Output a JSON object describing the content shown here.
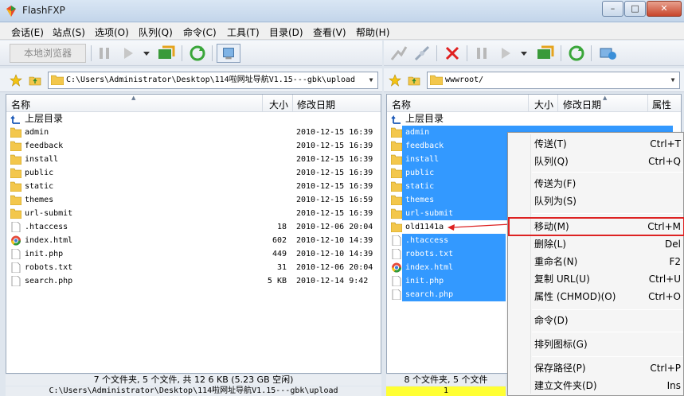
{
  "window": {
    "title": "FlashFXP",
    "min_label": "–",
    "max_label": "□",
    "close_label": "✕"
  },
  "menu": [
    "会话(E)",
    "站点(S)",
    "选项(O)",
    "队列(Q)",
    "命令(C)",
    "工具(T)",
    "目录(D)",
    "查看(V)",
    "帮助(H)"
  ],
  "toolbar_left": {
    "local_browser_label": "本地浏览器"
  },
  "left_pane": {
    "path": "C:\\Users\\Administrator\\Desktop\\114啦网址导航V1.15---gbk\\upload",
    "columns": {
      "name": "名称",
      "size": "大小",
      "date": "修改日期"
    },
    "up_label": "上层目录",
    "rows": [
      {
        "name": "admin",
        "size": "",
        "date": "2010-12-15 16:39",
        "type": "folder"
      },
      {
        "name": "feedback",
        "size": "",
        "date": "2010-12-15 16:39",
        "type": "folder"
      },
      {
        "name": "install",
        "size": "",
        "date": "2010-12-15 16:39",
        "type": "folder"
      },
      {
        "name": "public",
        "size": "",
        "date": "2010-12-15 16:39",
        "type": "folder"
      },
      {
        "name": "static",
        "size": "",
        "date": "2010-12-15 16:39",
        "type": "folder"
      },
      {
        "name": "themes",
        "size": "",
        "date": "2010-12-15 16:59",
        "type": "folder"
      },
      {
        "name": "url-submit",
        "size": "",
        "date": "2010-12-15 16:39",
        "type": "folder"
      },
      {
        "name": ".htaccess",
        "size": "18",
        "date": "2010-12-06 20:04",
        "type": "file"
      },
      {
        "name": "index.html",
        "size": "602",
        "date": "2010-12-10 14:39",
        "type": "html"
      },
      {
        "name": "init.php",
        "size": "449",
        "date": "2010-12-10 14:39",
        "type": "file"
      },
      {
        "name": "robots.txt",
        "size": "31",
        "date": "2010-12-06 20:04",
        "type": "file"
      },
      {
        "name": "search.php",
        "size": "5 KB",
        "date": "2010-12-14 9:42",
        "type": "file"
      }
    ],
    "status": "7 个文件夹, 5 个文件, 共 12 6 KB (5.23 GB 空闲)",
    "path_status": "C:\\Users\\Administrator\\Desktop\\114啦网址导航V1.15---gbk\\upload"
  },
  "right_pane": {
    "path": "wwwroot/",
    "columns": {
      "name": "名称",
      "size": "大小",
      "date": "修改日期",
      "attr": "属性"
    },
    "up_label": "上层目录",
    "rows": [
      {
        "name": "admin",
        "type": "folder",
        "selected": true
      },
      {
        "name": "feedback",
        "type": "folder",
        "selected": true
      },
      {
        "name": "install",
        "type": "folder",
        "selected": true
      },
      {
        "name": "public",
        "type": "folder",
        "selected": true
      },
      {
        "name": "static",
        "type": "folder",
        "selected": true
      },
      {
        "name": "themes",
        "type": "folder",
        "selected": true
      },
      {
        "name": "url-submit",
        "type": "folder",
        "selected": true
      },
      {
        "name": "old1141a",
        "type": "folder",
        "selected": false
      },
      {
        "name": ".htaccess",
        "type": "file",
        "selected": true
      },
      {
        "name": "robots.txt",
        "type": "file",
        "selected": true
      },
      {
        "name": "index.html",
        "type": "html",
        "selected": true
      },
      {
        "name": "init.php",
        "type": "file",
        "selected": true
      },
      {
        "name": "search.php",
        "type": "file",
        "selected": true
      }
    ],
    "status": "8 个文件夹, 5 个文件",
    "path_status": "1"
  },
  "context_menu": [
    {
      "label": "传送(T)",
      "shortcut": "Ctrl+T"
    },
    {
      "label": "队列(Q)",
      "shortcut": "Ctrl+Q"
    },
    {
      "label": "传送为(F)",
      "shortcut": ""
    },
    {
      "label": "队列为(S)",
      "shortcut": ""
    },
    {
      "label": "移动(M)",
      "shortcut": "Ctrl+M"
    },
    {
      "label": "删除(L)",
      "shortcut": "Del"
    },
    {
      "label": "重命名(N)",
      "shortcut": "F2"
    },
    {
      "label": "复制 URL(U)",
      "shortcut": "Ctrl+U"
    },
    {
      "label": "属性 (CHMOD)(O)",
      "shortcut": "Ctrl+O"
    },
    {
      "label": "命令(D)",
      "shortcut": ""
    },
    {
      "label": "排列图标(G)",
      "shortcut": ""
    },
    {
      "label": "保存路径(P)",
      "shortcut": "Ctrl+P"
    },
    {
      "label": "建立文件夹(D)",
      "shortcut": "Ins"
    }
  ],
  "colors": {
    "selection": "#3399ff",
    "highlight_box": "#dd2222",
    "status_path_right": "#ffff33"
  }
}
